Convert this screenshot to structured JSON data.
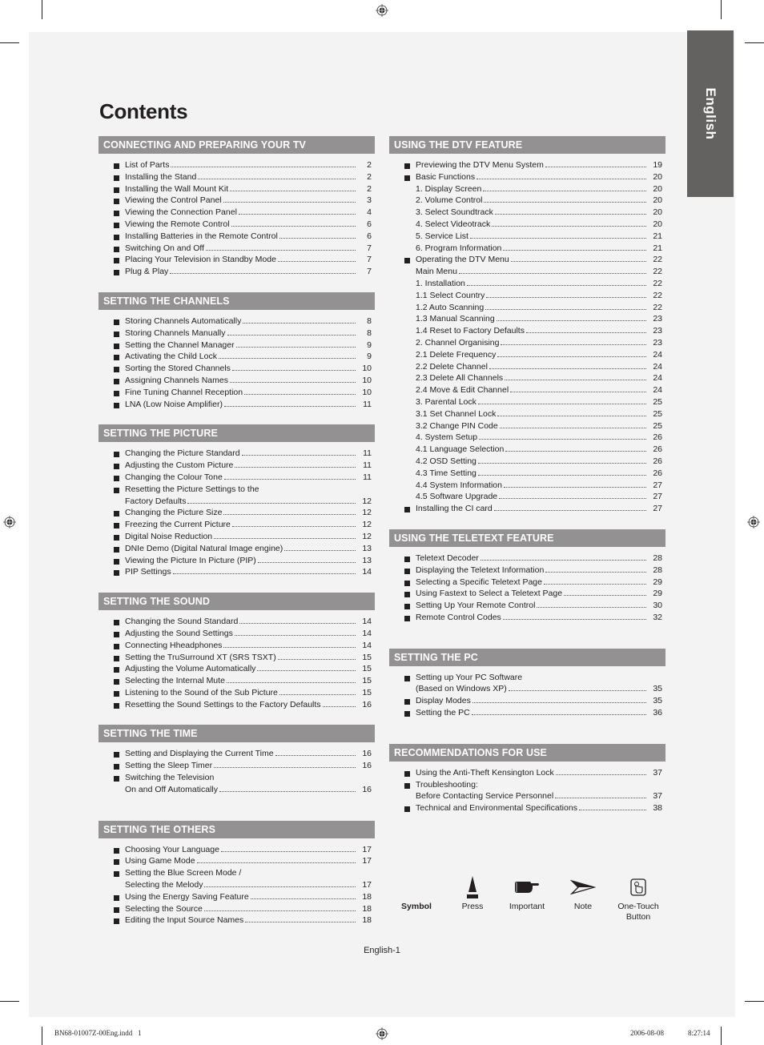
{
  "title": "Contents",
  "language_tab": "English",
  "left_column": [
    {
      "header": "CONNECTING AND PREPARING YOUR TV",
      "entries": [
        {
          "text": "List of Parts",
          "page": "2",
          "bullet": true
        },
        {
          "text": "Installing the Stand",
          "page": "2",
          "bullet": true
        },
        {
          "text": "Installing the Wall Mount Kit",
          "page": "2",
          "bullet": true
        },
        {
          "text": "Viewing the Control Panel",
          "page": "3",
          "bullet": true
        },
        {
          "text": "Viewing the Connection Panel",
          "page": "4",
          "bullet": true
        },
        {
          "text": "Viewing the Remote Control",
          "page": "6",
          "bullet": true
        },
        {
          "text": "Installing Batteries in the Remote Control",
          "page": "6",
          "bullet": true
        },
        {
          "text": "Switching On and Off",
          "page": "7",
          "bullet": true
        },
        {
          "text": "Placing Your Television in Standby Mode",
          "page": "7",
          "bullet": true
        },
        {
          "text": "Plug & Play",
          "page": "7",
          "bullet": true
        }
      ]
    },
    {
      "header": "SETTING THE CHANNELS",
      "entries": [
        {
          "text": "Storing Channels Automatically",
          "page": "8",
          "bullet": true
        },
        {
          "text": "Storing Channels Manually",
          "page": "8",
          "bullet": true
        },
        {
          "text": "Setting the Channel Manager",
          "page": "9",
          "bullet": true
        },
        {
          "text": "Activating the Child Lock",
          "page": "9",
          "bullet": true
        },
        {
          "text": "Sorting the Stored Channels",
          "page": "10",
          "bullet": true
        },
        {
          "text": "Assigning Channels Names",
          "page": "10",
          "bullet": true
        },
        {
          "text": "Fine Tuning Channel Reception",
          "page": "10",
          "bullet": true
        },
        {
          "text": "LNA (Low Noise Amplifier)",
          "page": "11",
          "bullet": true
        }
      ]
    },
    {
      "header": "SETTING THE PICTURE",
      "entries": [
        {
          "text": "Changing the Picture Standard",
          "page": "11",
          "bullet": true
        },
        {
          "text": "Adjusting the Custom Picture",
          "page": "11",
          "bullet": true
        },
        {
          "text": "Changing the Colour Tone",
          "page": "11",
          "bullet": true
        },
        {
          "text": "Resetting the Picture Settings to the",
          "page": "",
          "bullet": true
        },
        {
          "text": "Factory Defaults",
          "page": "12",
          "bullet": false
        },
        {
          "text": "Changing the Picture Size",
          "page": "12",
          "bullet": true
        },
        {
          "text": "Freezing the Current Picture",
          "page": "12",
          "bullet": true
        },
        {
          "text": "Digital Noise Reduction",
          "page": "12",
          "bullet": true
        },
        {
          "text": "DNIe Demo (Digital Natural Image engine)",
          "page": "13",
          "bullet": true
        },
        {
          "text": "Viewing the Picture In Picture (PIP)",
          "page": "13",
          "bullet": true
        },
        {
          "text": "PIP Settings",
          "page": "14",
          "bullet": true
        }
      ]
    },
    {
      "header": "SETTING THE SOUND",
      "entries": [
        {
          "text": "Changing the Sound Standard",
          "page": "14",
          "bullet": true
        },
        {
          "text": "Adjusting the Sound Settings",
          "page": "14",
          "bullet": true
        },
        {
          "text": "Connecting Hheadphones",
          "page": "14",
          "bullet": true
        },
        {
          "text": "Setting the TruSurround XT (SRS TSXT)",
          "page": "15",
          "bullet": true
        },
        {
          "text": "Adjusting the Volume Automatically",
          "page": "15",
          "bullet": true
        },
        {
          "text": "Selecting the Internal Mute",
          "page": "15",
          "bullet": true
        },
        {
          "text": "Listening to the Sound of the Sub Picture",
          "page": "15",
          "bullet": true
        },
        {
          "text": "Resetting the Sound Settings to the Factory Defaults",
          "page": "16",
          "bullet": true
        }
      ]
    },
    {
      "header": "SETTING THE TIME",
      "entries": [
        {
          "text": "Setting and Displaying the Current Time",
          "page": "16",
          "bullet": true
        },
        {
          "text": "Setting the Sleep Timer",
          "page": "16",
          "bullet": true
        },
        {
          "text": "Switching the Television",
          "page": "",
          "bullet": true
        },
        {
          "text": "On and Off Automatically",
          "page": "16",
          "bullet": false
        }
      ]
    },
    {
      "header": "SETTING THE OTHERS",
      "entries": [
        {
          "text": "Choosing Your Language",
          "page": "17",
          "bullet": true
        },
        {
          "text": "Using Game Mode",
          "page": "17",
          "bullet": true
        },
        {
          "text": "Setting the Blue Screen Mode /",
          "page": "",
          "bullet": true
        },
        {
          "text": "Selecting the Melody",
          "page": "17",
          "bullet": false
        },
        {
          "text": "Using the Energy Saving Feature",
          "page": "18",
          "bullet": true
        },
        {
          "text": "Selecting the Source",
          "page": "18",
          "bullet": true
        },
        {
          "text": "Editing the Input Source Names",
          "page": "18",
          "bullet": true
        }
      ]
    }
  ],
  "right_column": [
    {
      "header": "USING THE DTV FEATURE",
      "entries": [
        {
          "text": "Previewing the DTV Menu System",
          "page": "19",
          "bullet": true
        },
        {
          "text": "Basic Functions",
          "page": "20",
          "bullet": true
        },
        {
          "text": "1. Display Screen",
          "page": "20",
          "bullet": false
        },
        {
          "text": "2. Volume Control",
          "page": "20",
          "bullet": false
        },
        {
          "text": "3. Select Soundtrack",
          "page": "20",
          "bullet": false
        },
        {
          "text": "4. Select Videotrack",
          "page": "20",
          "bullet": false
        },
        {
          "text": "5.  Service List",
          "page": "21",
          "bullet": false
        },
        {
          "text": "6.  Program Information",
          "page": "21",
          "bullet": false
        },
        {
          "text": "Operating the DTV Menu",
          "page": "22",
          "bullet": true
        },
        {
          "text": "Main Menu",
          "page": "22",
          "bullet": false
        },
        {
          "text": "1. Installation",
          "page": "22",
          "bullet": false
        },
        {
          "text": "1.1 Select Country",
          "page": "22",
          "bullet": false
        },
        {
          "text": "1.2 Auto Scanning",
          "page": "22",
          "bullet": false
        },
        {
          "text": "1.3 Manual Scanning",
          "page": "23",
          "bullet": false
        },
        {
          "text": "1.4 Reset to Factory Defaults",
          "page": "23",
          "bullet": false
        },
        {
          "text": "2. Channel Organising",
          "page": "23",
          "bullet": false
        },
        {
          "text": "2.1 Delete Frequency",
          "page": "24",
          "bullet": false
        },
        {
          "text": "2.2 Delete Channel",
          "page": "24",
          "bullet": false
        },
        {
          "text": "2.3 Delete All Channels",
          "page": "24",
          "bullet": false
        },
        {
          "text": "2.4 Move & Edit Channel",
          "page": "24",
          "bullet": false
        },
        {
          "text": "3. Parental Lock",
          "page": "25",
          "bullet": false
        },
        {
          "text": "3.1 Set Channel Lock",
          "page": "25",
          "bullet": false
        },
        {
          "text": "3.2 Change PIN Code",
          "page": "25",
          "bullet": false
        },
        {
          "text": "4. System Setup",
          "page": "26",
          "bullet": false
        },
        {
          "text": "4.1 Language Selection",
          "page": "26",
          "bullet": false
        },
        {
          "text": "4.2 OSD Setting",
          "page": "26",
          "bullet": false
        },
        {
          "text": "4.3 Time Setting",
          "page": "26",
          "bullet": false
        },
        {
          "text": "4.4 System Information",
          "page": "27",
          "bullet": false
        },
        {
          "text": "4.5 Software Upgrade",
          "page": "27",
          "bullet": false
        },
        {
          "text": "Installing the CI card",
          "page": "27",
          "bullet": true
        }
      ]
    },
    {
      "header": "USING THE TELETEXT FEATURE",
      "entries": [
        {
          "text": "Teletext Decoder",
          "page": "28",
          "bullet": true
        },
        {
          "text": "Displaying the Teletext Information",
          "page": "28",
          "bullet": true
        },
        {
          "text": "Selecting a Specific Teletext Page",
          "page": "29",
          "bullet": true
        },
        {
          "text": "Using Fastext to Select a Teletext Page",
          "page": "29",
          "bullet": true
        },
        {
          "text": "Setting Up Your Remote Control",
          "page": "30",
          "bullet": true
        },
        {
          "text": "Remote Control Codes",
          "page": "32",
          "bullet": true
        }
      ]
    },
    {
      "header": "SETTING THE PC",
      "entries": [
        {
          "text": "Setting up Your PC Software",
          "page": "",
          "bullet": true
        },
        {
          "text": "(Based on Windows XP)",
          "page": "35",
          "bullet": false
        },
        {
          "text": "Display Modes",
          "page": "35",
          "bullet": true
        },
        {
          "text": "Setting the PC",
          "page": "36",
          "bullet": true
        }
      ]
    },
    {
      "header": "RECOMMENDATIONS FOR USE",
      "entries": [
        {
          "text": "Using the Anti-Theft Kensington Lock",
          "page": "37",
          "bullet": true
        },
        {
          "text": "Troubleshooting:",
          "page": "",
          "bullet": true
        },
        {
          "text": "Before Contacting Service Personnel",
          "page": "37",
          "bullet": false
        },
        {
          "text": "Technical and Environmental Specifications",
          "page": "38",
          "bullet": true
        }
      ]
    }
  ],
  "symbols": {
    "heading": "Symbol",
    "items": [
      {
        "icon": "press-icon",
        "label": "Press"
      },
      {
        "icon": "important-icon",
        "label": "Important"
      },
      {
        "icon": "note-icon",
        "label": "Note"
      },
      {
        "icon": "one-touch-button-icon",
        "label": "One-Touch Button"
      }
    ]
  },
  "footer": {
    "page_label": "English-1",
    "file_slug": "BN68-01007Z-00Eng.indd   1",
    "date": "2006-08-08",
    "time": "8:27:14"
  }
}
